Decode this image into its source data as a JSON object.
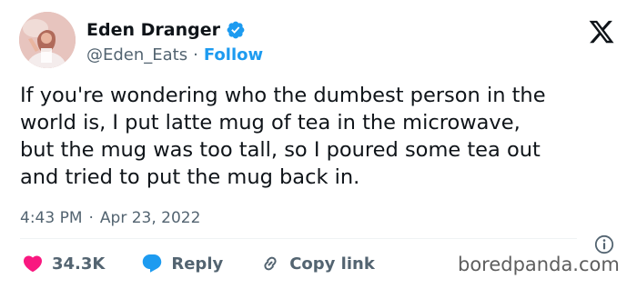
{
  "author": {
    "display_name": "Eden Dranger",
    "handle": "@Eden_Eats",
    "separator": "·",
    "follow_label": "Follow"
  },
  "tweet": {
    "lines": [
      "If you're wondering who the dumbest person in the",
      "world is, I put latte mug of tea in the microwave,",
      "but the mug was too tall, so I poured some tea out",
      "and tried to put the mug back in."
    ]
  },
  "meta": {
    "time": "4:43 PM",
    "separator": "·",
    "date": "Apr 23, 2022"
  },
  "actions": {
    "likes": "34.3K",
    "reply": "Reply",
    "copy_link": "Copy link"
  },
  "watermark": "boredpanda.com",
  "colors": {
    "text": "#0f1419",
    "secondary": "#536471",
    "accent": "#1d9bf0",
    "like": "#f91880",
    "divider": "#eff3f4"
  },
  "icons": {
    "verified": "verified-badge-icon",
    "logo": "x-logo-icon",
    "info": "info-icon",
    "like": "heart-icon",
    "reply": "reply-bubble-icon",
    "copy": "link-icon"
  }
}
